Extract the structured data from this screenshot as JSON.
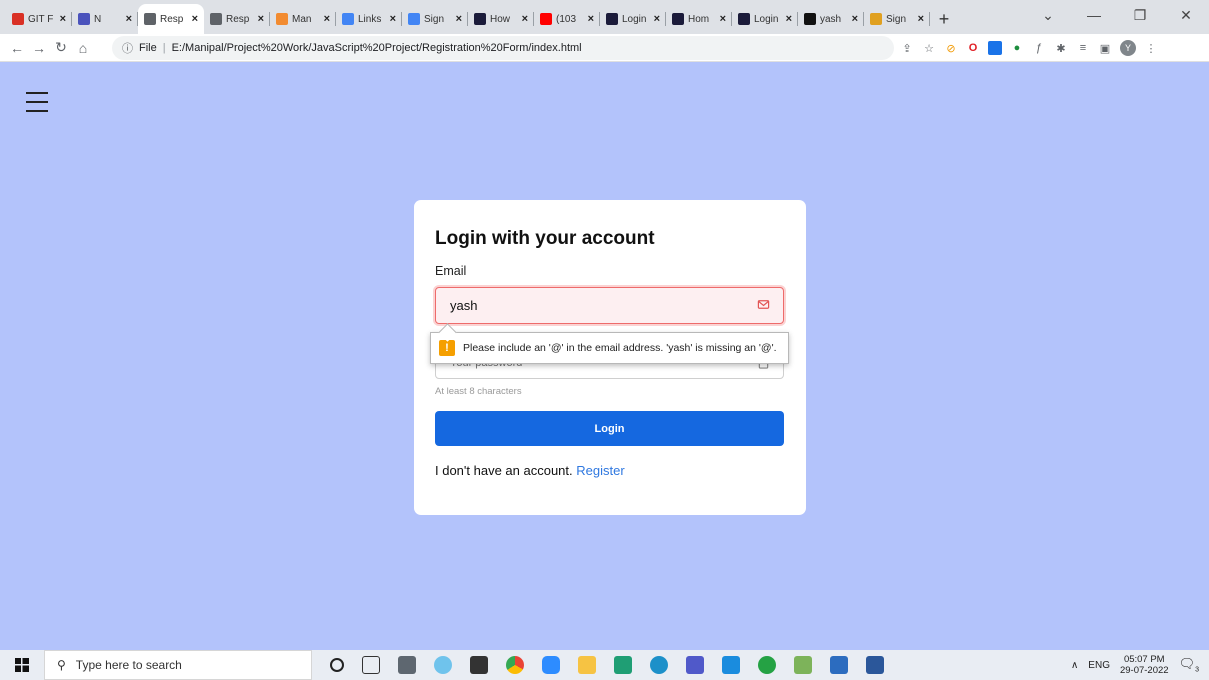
{
  "browser": {
    "tabs": [
      {
        "label": "GIT F",
        "color": "#d93025",
        "active": false
      },
      {
        "label": "N",
        "color": "#4b53bc",
        "active": false
      },
      {
        "label": "Resp",
        "color": "#5f6368",
        "active": true
      },
      {
        "label": "Resp",
        "color": "#5f6368",
        "active": false
      },
      {
        "label": "Man",
        "color": "#f28b30",
        "active": false
      },
      {
        "label": "Links",
        "color": "#4285f4",
        "active": false
      },
      {
        "label": "Sign",
        "color": "#4285f4",
        "active": false
      },
      {
        "label": "How",
        "color": "#1b1b3a",
        "active": false
      },
      {
        "label": "(103",
        "color": "#ff0000",
        "active": false
      },
      {
        "label": "Login",
        "color": "#1b1b3a",
        "active": false
      },
      {
        "label": "Hom",
        "color": "#1b1b3a",
        "active": false
      },
      {
        "label": "Login",
        "color": "#1b1b3a",
        "active": false
      },
      {
        "label": "yash",
        "color": "#111111",
        "active": false
      },
      {
        "label": "Sign",
        "color": "#e0a020",
        "active": false
      }
    ],
    "url_prefix": "File",
    "url": "E:/Manipal/Project%20Work/JavaScript%20Project/Registration%20Form/index.html",
    "profile_initial": "Y"
  },
  "page": {
    "card_title": "Login with your account",
    "email_label": "Email",
    "email_value": "yash",
    "password_placeholder": "Your password",
    "password_hint": "At least 8 characters",
    "login_button": "Login",
    "register_prefix": "I don't have an account.",
    "register_link": "Register",
    "validation_message": "Please include an '@' in the email address. 'yash' is missing an '@'.",
    "validation_icon": "!"
  },
  "taskbar": {
    "search_placeholder": "Type here to search",
    "language": "ENG",
    "time": "05:07 PM",
    "date": "29-07-2022",
    "notification_count": "3"
  },
  "colors": {
    "page_background": "#b3c3fb",
    "primary": "#1568e0",
    "link": "#2f78e0",
    "error_border": "#ee6b6b",
    "warning": "#f59f00"
  }
}
